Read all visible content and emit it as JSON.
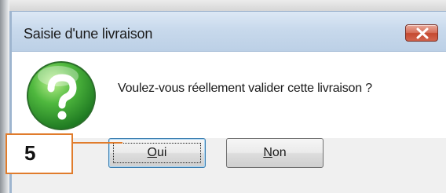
{
  "dialog": {
    "title": "Saisie d'une livraison",
    "message": "Voulez-vous réellement valider cette livraison ?",
    "icon": "question-icon",
    "buttons": {
      "yes_label": "Oui",
      "yes_accel": "O",
      "yes_rest": "ui",
      "no_label": "Non",
      "no_accel": "N",
      "no_rest": "on"
    }
  },
  "annotation": {
    "step_number": "5"
  },
  "colors": {
    "accent": "#e07c2c",
    "titlebar": "#c8d9ec",
    "close_button": "#c54a31",
    "icon_green": "#3aa63a"
  }
}
